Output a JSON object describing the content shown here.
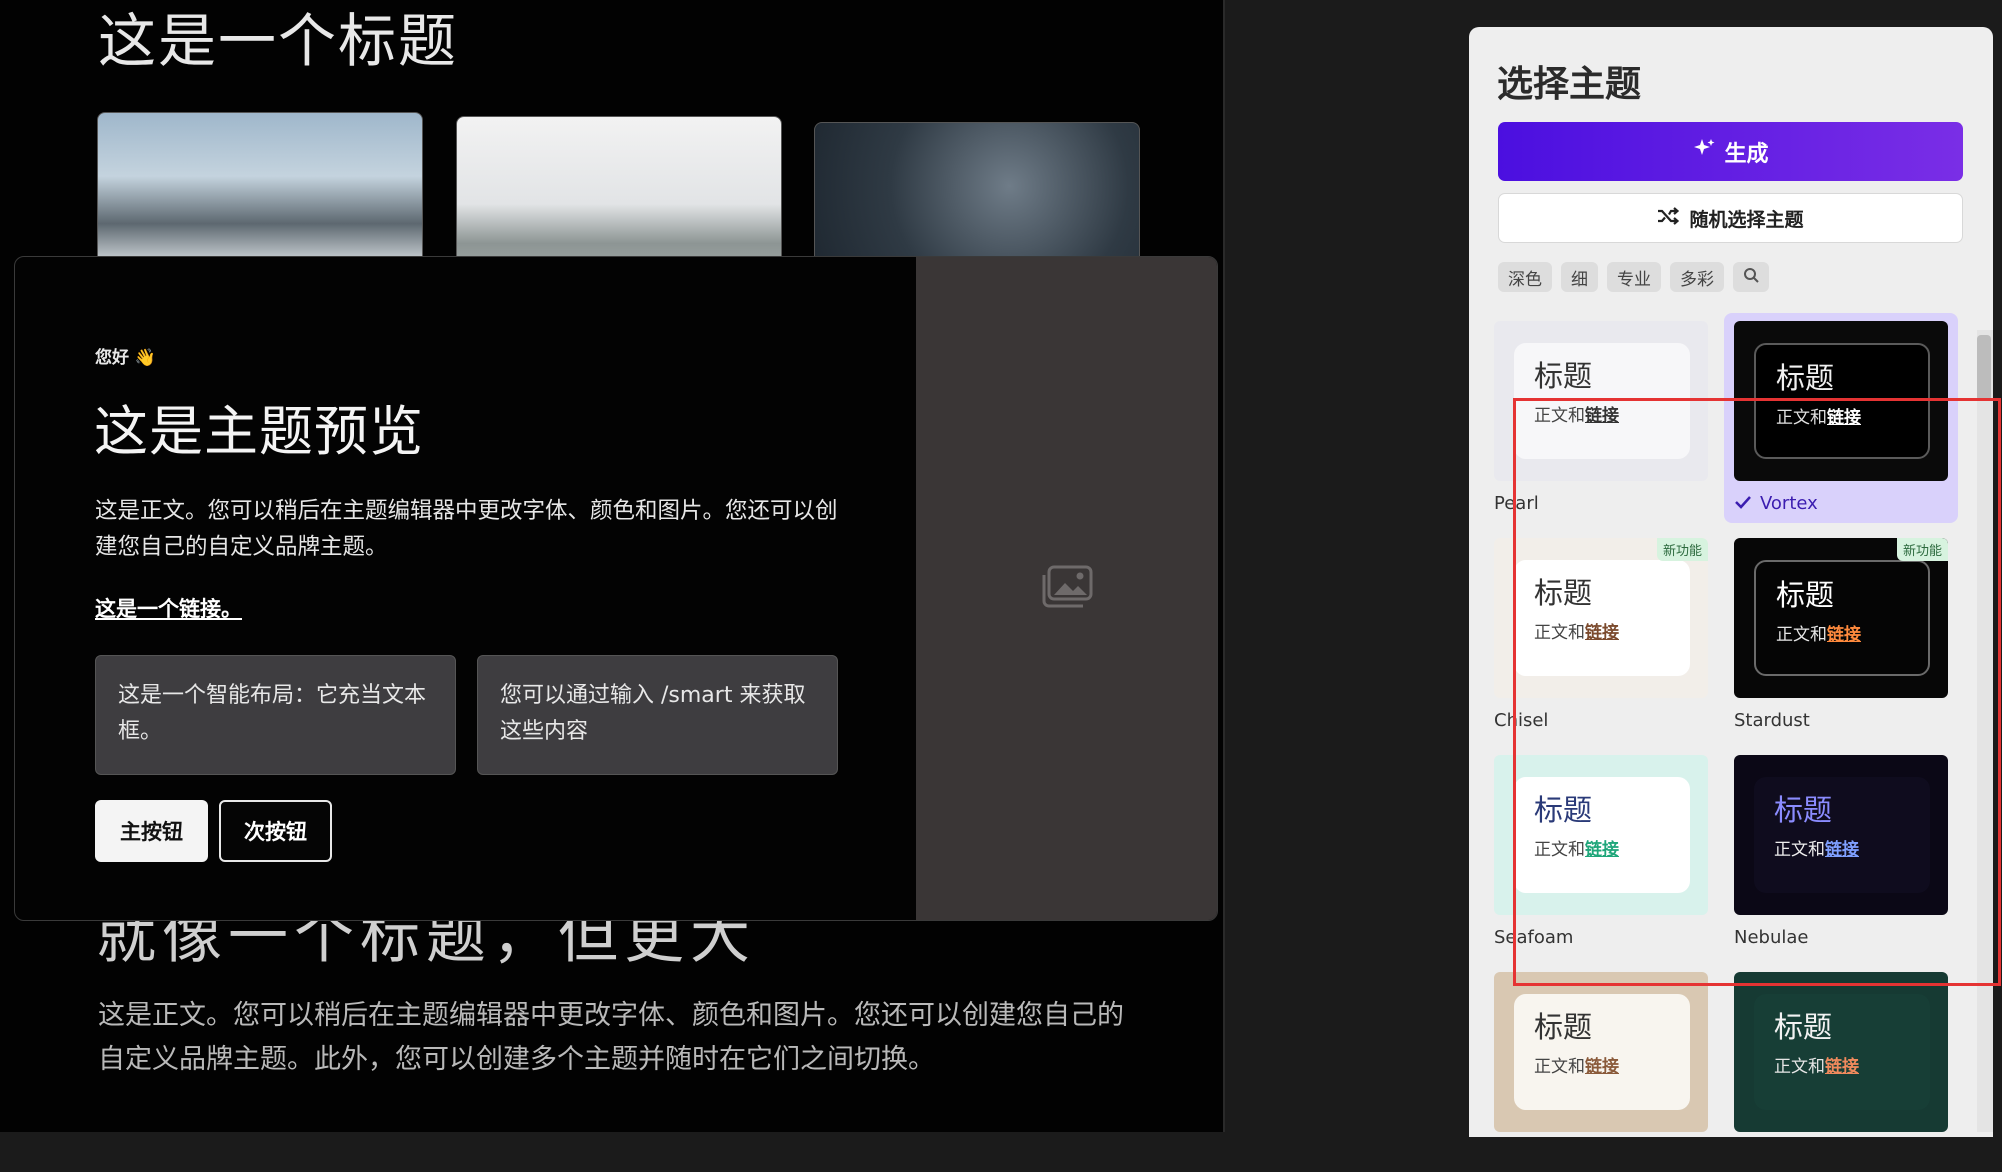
{
  "background_slide": {
    "title": "这是一个标题",
    "big_heading": "就像一个标题，但更大",
    "body": "这是正文。您可以稍后在主题编辑器中更改字体、颜色和图片。您还可以创建您自己的自定义品牌主题。此外，您可以创建多个主题并随时在它们之间切换。"
  },
  "preview": {
    "greeting": "您好 👋",
    "title": "这是主题预览",
    "body": "这是正文。您可以稍后在主题编辑器中更改字体、颜色和图片。您还可以创建您自己的自定义品牌主题。",
    "link": "这是一个链接。",
    "smart_box_1": "这是一个智能布局：它充当文本框。",
    "smart_box_2": "您可以通过输入 /smart 来获取这些内容",
    "primary_button": "主按钮",
    "secondary_button": "次按钮",
    "image_icon": "image-placeholder-icon"
  },
  "panel": {
    "title": "选择主题",
    "generate_label": "生成",
    "random_label": "随机选择主题",
    "tags": [
      "深色",
      "细",
      "专业",
      "多彩"
    ],
    "search_icon": "search-icon",
    "sample_title": "标题",
    "sample_body": "正文和",
    "sample_link": "链接",
    "new_badge": "新功能",
    "themes": [
      {
        "name": "Pearl",
        "selected": false,
        "new": false,
        "bg": "#e9e9ee",
        "card": "#f7f7f9",
        "title_color": "#333333",
        "body_color": "#444444",
        "link_color": "#333333",
        "border": "none"
      },
      {
        "name": "Vortex",
        "selected": true,
        "new": false,
        "bg": "#0a0a0a",
        "card": "#000000",
        "title_color": "#f0f0f0",
        "body_color": "#e0e0e0",
        "link_color": "#ffffff",
        "border": "#5a5a5a"
      },
      {
        "name": "Chisel",
        "selected": false,
        "new": true,
        "bg": "#f2eee9",
        "card": "#ffffff",
        "title_color": "#333333",
        "body_color": "#444444",
        "link_color": "#7b4a2d",
        "border": "none"
      },
      {
        "name": "Stardust",
        "selected": false,
        "new": true,
        "bg": "#070707",
        "card": "#050505",
        "title_color": "#ffffff",
        "body_color": "#e6e6e6",
        "link_color": "#ff8a3d",
        "border": "#6a6a6a"
      },
      {
        "name": "Seafoam",
        "selected": false,
        "new": false,
        "bg": "#d8f2ec",
        "card": "#ffffff",
        "title_color": "#2a3a78",
        "body_color": "#444444",
        "link_color": "#1fa67a",
        "border": "none"
      },
      {
        "name": "Nebulae",
        "selected": false,
        "new": false,
        "bg": "#0b0816",
        "card": "#0f0c1e",
        "title_color": "#8b8cff",
        "body_color": "#eeeeee",
        "link_color": "#7fa0ff",
        "border": "none"
      },
      {
        "name": "",
        "selected": false,
        "new": false,
        "bg": "#d9c8b2",
        "card": "#f8f5ef",
        "title_color": "#333333",
        "body_color": "#444444",
        "link_color": "#8a5a3a",
        "border": "none"
      },
      {
        "name": "",
        "selected": false,
        "new": false,
        "bg": "#163a33",
        "card": "#173e36",
        "title_color": "#f2f2f2",
        "body_color": "#e6e6e6",
        "link_color": "#f08a5d",
        "border": "none"
      }
    ]
  },
  "accent_colors": {
    "generate_gradient_start": "#4b0fe0",
    "generate_gradient_end": "#7a2ee6",
    "selected_bg": "#d9d1fb",
    "annotation": "#e53333"
  }
}
